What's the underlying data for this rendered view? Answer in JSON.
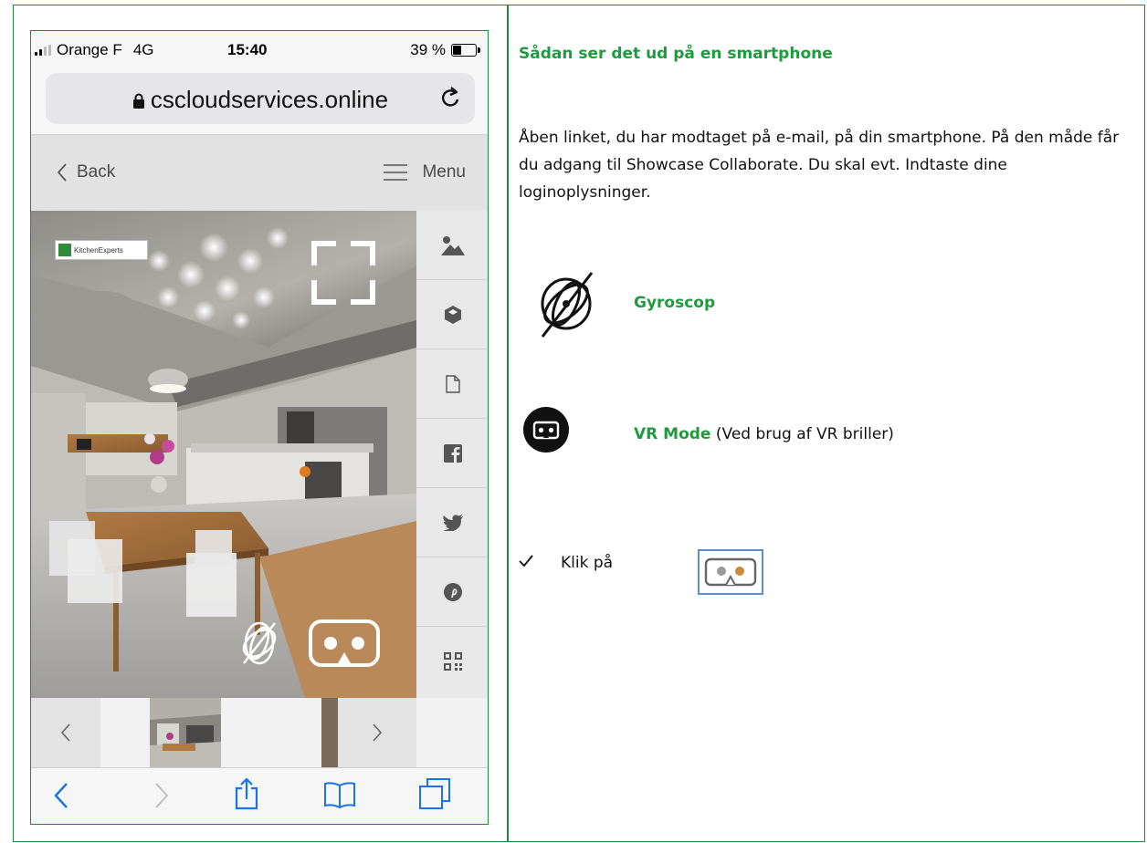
{
  "phone": {
    "status": {
      "carrier": "Orange F",
      "network": "4G",
      "time": "15:40",
      "battery": "39 %",
      "battery_level": 0.39
    },
    "url_bar": {
      "url": "cscloudservices.online"
    },
    "nav": {
      "back_label": "Back",
      "menu_label": "Menu"
    },
    "brand_badge": "KitchenExperts",
    "side_icons": [
      "image-icon",
      "cube-icon",
      "document-icon",
      "facebook-icon",
      "twitter-icon",
      "pinterest-icon",
      "qr-code-icon"
    ],
    "bottom_toolbar": [
      "back-arrow-icon",
      "forward-arrow-icon",
      "share-icon",
      "bookmarks-icon",
      "tabs-icon"
    ]
  },
  "content": {
    "heading": "Sådan ser det ud på en smartphone",
    "intro": "Åben linket, du har modtaget på e-mail, på din smartphone. På den måde får du adgang til Showcase Collaborate. Du skal evt. Indtaste dine loginoplysninger.",
    "gyro_label": "Gyroscop",
    "vr_label": "VR Mode",
    "vr_note": " (Ved brug af VR briller)",
    "check_text": "Klik på"
  },
  "colors": {
    "accent_green": "#1f9a3f",
    "border_green": "#1f8a3a"
  }
}
